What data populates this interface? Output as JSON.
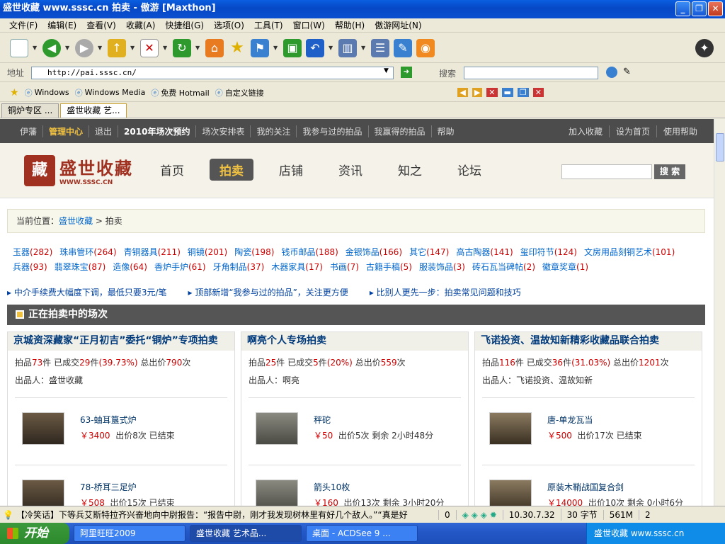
{
  "window": {
    "title": "盛世收藏 www.sssc.cn 拍卖 - 傲游 [Maxthon]"
  },
  "menu": [
    "文件(F)",
    "编辑(E)",
    "查看(V)",
    "收藏(A)",
    "快捷组(G)",
    "选项(O)",
    "工具(T)",
    "窗口(W)",
    "帮助(H)",
    "傲游网址(N)"
  ],
  "address": {
    "label": "地址",
    "url": "http://pai.sssc.cn/",
    "search_label": "搜索"
  },
  "links": [
    "Windows",
    "Windows Media",
    "免费 Hotmail",
    "自定义链接"
  ],
  "tabs": [
    "铜炉专区 ...",
    "盛世收藏 艺..."
  ],
  "site": {
    "topnav": [
      "伊藩",
      "管理中心",
      "退出",
      "2010年场次预约",
      "场次安排表",
      "我的关注",
      "我参与过的拍品",
      "我赢得的拍品",
      "帮助"
    ],
    "topnav_right": [
      "加入收藏",
      "设为首页",
      "使用帮助"
    ],
    "brand": "盛世收藏",
    "brand_url": "WWW.SSSC.CN",
    "seal": "藏",
    "mainnav": [
      "首页",
      "拍卖",
      "店铺",
      "资讯",
      "知之",
      "论坛"
    ],
    "search_btn": "搜 索",
    "crumb": {
      "prefix": "当前位置：",
      "home": "盛世收藏",
      "sep": " > ",
      "here": "拍卖"
    },
    "categories": [
      {
        "name": "玉器",
        "count": "(282)"
      },
      {
        "name": "珠串管环",
        "count": "(264)"
      },
      {
        "name": "青铜器具",
        "count": "(211)"
      },
      {
        "name": "铜镜",
        "count": "(201)"
      },
      {
        "name": "陶瓷",
        "count": "(198)"
      },
      {
        "name": "钱币邮品",
        "count": "(188)"
      },
      {
        "name": "金银饰品",
        "count": "(166)"
      },
      {
        "name": "其它",
        "count": "(147)"
      },
      {
        "name": "高古陶器",
        "count": "(141)"
      },
      {
        "name": "玺印符节",
        "count": "(124)"
      },
      {
        "name": "文房用品刻铜艺术",
        "count": "(101)"
      },
      {
        "name": "兵器",
        "count": "(93)"
      },
      {
        "name": "翡翠珠宝",
        "count": "(87)"
      },
      {
        "name": "造像",
        "count": "(64)"
      },
      {
        "name": "香炉手炉",
        "count": "(61)"
      },
      {
        "name": "牙角制品",
        "count": "(37)"
      },
      {
        "name": "木器家具",
        "count": "(17)"
      },
      {
        "name": "书画",
        "count": "(7)"
      },
      {
        "name": "古籍手稿",
        "count": "(5)"
      },
      {
        "name": "服装饰品",
        "count": "(3)"
      },
      {
        "name": "砖石瓦当碑帖",
        "count": "(2)"
      },
      {
        "name": "徽章奖章",
        "count": "(1)"
      }
    ],
    "notices": [
      "中介手续费大幅度下调，最低只要3元/笔",
      "顶部新增“我参与过的拍品”，关注更方便",
      "比别人更先一步：拍卖常见问题和技巧"
    ],
    "section_title": "正在拍卖中的场次",
    "auctions": [
      {
        "title": "京城资深藏家“正月初吉”委托“铜炉”专项拍卖",
        "lots": "73",
        "sold": "29",
        "rate": "(39.73%)",
        "bids": "790",
        "owner": "盛世收藏",
        "items": [
          {
            "name": "63-蚰耳簋式炉",
            "price": "￥3400",
            "info": "出价8次 已结束"
          },
          {
            "name": "78-桥耳三足炉",
            "price": "￥508",
            "info": "出价15次 已结束"
          }
        ]
      },
      {
        "title": "啊亮个人专场拍卖",
        "lots": "25",
        "sold": "5",
        "rate": "(20%)",
        "bids": "559",
        "owner": "啊亮",
        "items": [
          {
            "name": "秤砣",
            "price": "￥50",
            "info": "出价5次 剩余 2小时48分"
          },
          {
            "name": "箭头10枚",
            "price": "￥160",
            "info": "出价13次 剩余 3小时20分"
          }
        ]
      },
      {
        "title": "飞诺投资、温故知新精彩收藏品联合拍卖",
        "lots": "116",
        "sold": "36",
        "rate": "(31.03%)",
        "bids": "1201",
        "owner": "飞诺投资、温故知新",
        "items": [
          {
            "name": "唐-单龙瓦当",
            "price": "￥500",
            "info": "出价17次 已结束"
          },
          {
            "name": "原装木鞘战国复合剑",
            "price": "￥14000",
            "info": "出价10次 剩余 0小时6分"
          }
        ]
      }
    ],
    "labels": {
      "lots": "拍品",
      "lots_unit": "件",
      "sold": "已成交",
      "bids": "总出价",
      "bids_unit": "次",
      "owner": "出品人："
    }
  },
  "statusbar": {
    "ticker": "【冷笑话】下等兵艾斯特拉齐兴奋地向中尉报告：“报告中尉，刚才我发现树林里有好几个敌人。”“真是好",
    "count": "0",
    "time": "10.30.7.32",
    "chars": "30 字节",
    "mem": "561M",
    "num": "2"
  },
  "taskbar": {
    "start": "开始",
    "tasks": [
      "阿里旺旺2009",
      "盛世收藏 艺术品...",
      "桌面 - ACDSee 9 ..."
    ],
    "tray": "盛世收藏 www.sssc.cn"
  },
  "colors": {
    "accent": "#c00",
    "link": "#06c",
    "nav_bg": "#4c4c4c",
    "nav_highlight": "#f0c040",
    "brand": "#a03020"
  }
}
